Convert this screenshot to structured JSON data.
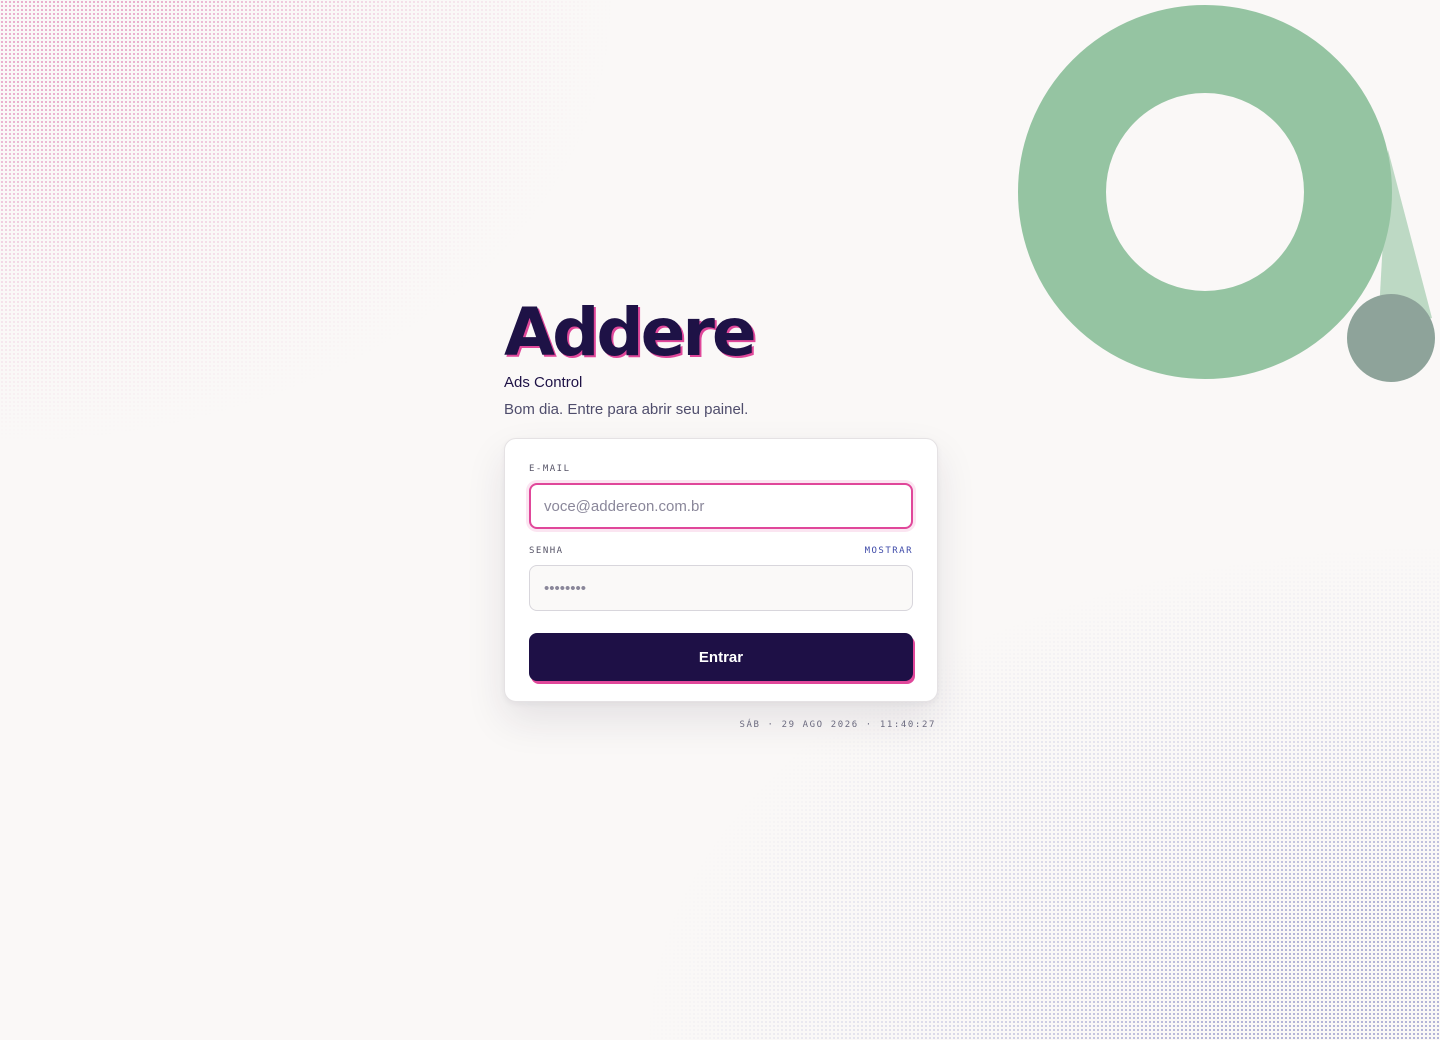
{
  "brand": {
    "logo_text": "Addere",
    "app_name": "Ads Control",
    "greeting": "Bom dia. Entre para abrir seu painel."
  },
  "form": {
    "email": {
      "label": "E-MAIL",
      "placeholder": "voce@addereon.com.br",
      "value": ""
    },
    "password": {
      "label": "SENHA",
      "toggle_label": "MOSTRAR",
      "placeholder": "••••••••",
      "value": ""
    },
    "submit_label": "Entrar"
  },
  "timestamp": "SÁB · 29 AGO 2026 · 11:40:27",
  "colors": {
    "brand_navy": "#1e1046",
    "accent_pink": "#e0479a",
    "deco_green": "#95c4a2",
    "deco_green_light": "#bdd9c4",
    "deco_gray": "#8ea39a",
    "background": "#faf8f7"
  },
  "decoration": {
    "icon": "ring-with-dot-icon"
  }
}
